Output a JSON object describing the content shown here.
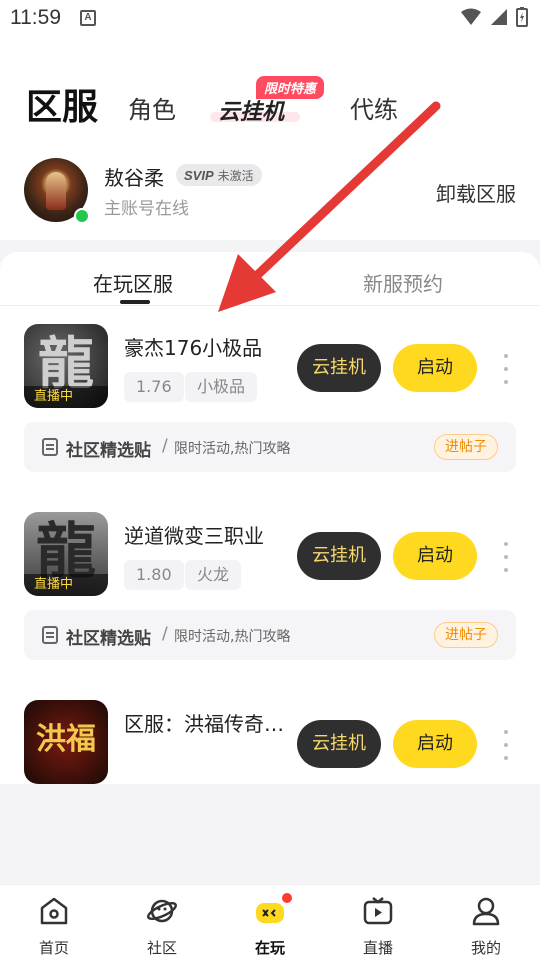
{
  "status_bar": {
    "time": "11:59",
    "notification_icon": "A"
  },
  "top_tabs": {
    "main": "区服",
    "role": "角色",
    "cloud": "云挂机",
    "cloud_badge": "限时特惠",
    "daili": "代练"
  },
  "profile": {
    "name": "敖谷柔",
    "svip_logo": "SVIP",
    "svip_status": "未激活",
    "subtitle": "主账号在线",
    "unload_label": "卸载区服"
  },
  "sub_tabs": {
    "playing": "在玩区服",
    "new_reserve": "新服预约"
  },
  "games": [
    {
      "title": "豪杰176小极品",
      "tags": [
        "1.76",
        "小极品"
      ],
      "live_label": "直播中",
      "icon_glyph": "龍",
      "cloud_label": "云挂机",
      "start_label": "启动",
      "community": {
        "label": "社区精选贴",
        "sep": "/",
        "desc": "限时活动,热门攻略",
        "post_label": "进帖子"
      }
    },
    {
      "title": "逆道微变三职业",
      "tags": [
        "1.80",
        "火龙"
      ],
      "live_label": "直播中",
      "icon_glyph": "龍",
      "cloud_label": "云挂机",
      "start_label": "启动",
      "community": {
        "label": "社区精选贴",
        "sep": "/",
        "desc": "限时活动,热门攻略",
        "post_label": "进帖子"
      }
    },
    {
      "title": "区服：洪福传奇…",
      "icon_glyph": "洪福",
      "cloud_label": "云挂机",
      "start_label": "启动"
    }
  ],
  "bottom_nav": [
    {
      "label": "首页",
      "icon": "home-icon"
    },
    {
      "label": "社区",
      "icon": "planet-icon"
    },
    {
      "label": "在玩",
      "icon": "gamepad-icon",
      "active": true
    },
    {
      "label": "直播",
      "icon": "tv-icon"
    },
    {
      "label": "我的",
      "icon": "person-icon"
    }
  ],
  "colors": {
    "accent_yellow": "#ffd91f",
    "dark_button": "#2f2f2f",
    "cloud_text": "#f7d96a",
    "arrow_red": "#e53935"
  }
}
